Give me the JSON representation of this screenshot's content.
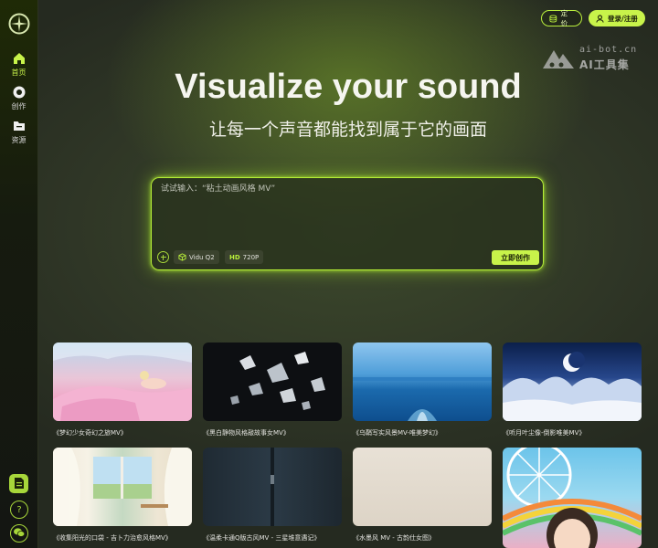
{
  "sidebar": {
    "items": [
      {
        "label": "首页",
        "icon": "home-icon",
        "active": true
      },
      {
        "label": "创作",
        "icon": "create-icon",
        "active": false
      },
      {
        "label": "资源",
        "icon": "folder-icon",
        "active": false
      }
    ],
    "bottom_icons": [
      "document-icon",
      "help-icon",
      "wechat-icon"
    ]
  },
  "header": {
    "pricing_label": "定价",
    "login_label": "登录/注册"
  },
  "watermark": {
    "url": "ai-bot.cn",
    "name": "AI工具集"
  },
  "hero": {
    "title": "Visualize your sound",
    "subtitle": "让每一个声音都能找到属于它的画面"
  },
  "prompt": {
    "placeholder": "试试输入：“粘土动画风格 MV”",
    "model_chip": "Vidu Q2",
    "resolution_badge": "HD",
    "resolution_value": "720P",
    "create_label": "立即创作"
  },
  "gallery": [
    {
      "caption": "《梦幻少女奇幻之旅MV》"
    },
    {
      "caption": "《黑白静物风格敲故事女MV》"
    },
    {
      "caption": "《乌鞘写实风景MV-唯美梦幻》"
    },
    {
      "caption": "《听月叶尘像-倒影唯美MV》"
    },
    {
      "caption": "《收集阳光的口袋 - 吉卜力治愈风格MV》"
    },
    {
      "caption": "《温柔卡通Q版古风MV - 三星堆意遇记》"
    },
    {
      "caption": "《水墨风 MV - 古韵仕女图》"
    },
    {
      "caption": ""
    }
  ],
  "colors": {
    "accent": "#c8f34a",
    "sidebar_bg": "#161b0f",
    "main_bg": "#2f3626"
  }
}
